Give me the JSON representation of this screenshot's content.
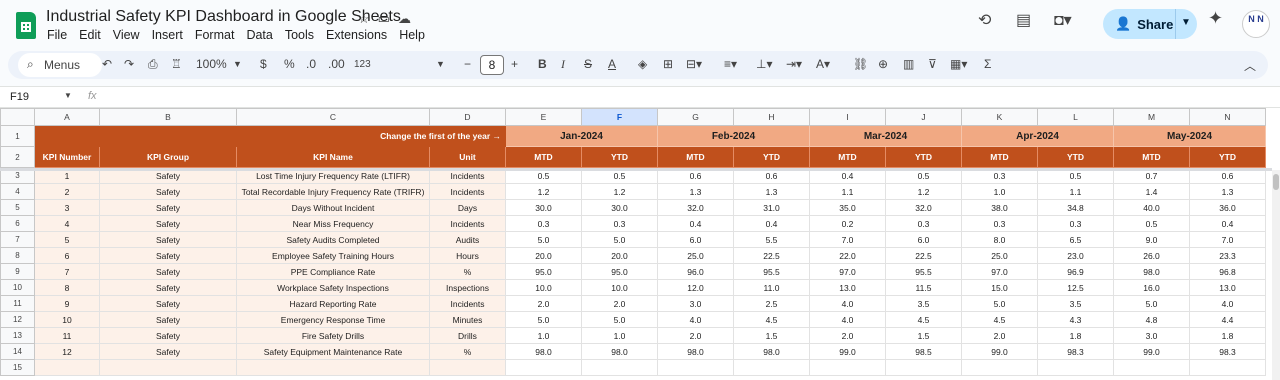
{
  "app": {
    "title": "Industrial Safety KPI Dashboard in Google Sheets",
    "menus": [
      "File",
      "Edit",
      "View",
      "Insert",
      "Format",
      "Data",
      "Tools",
      "Extensions",
      "Help"
    ],
    "share_label": "Share",
    "avatar_text": "N N"
  },
  "toolbar": {
    "menus_label": "Menus",
    "zoom": "100%",
    "currency": "$",
    "percent": "%",
    "dec_decrease": ".0",
    "dec_increase": ".00",
    "number_format": "123",
    "font_size": "8"
  },
  "formula_bar": {
    "cell_ref": "F19",
    "fx": "fx"
  },
  "columns": [
    "A",
    "B",
    "C",
    "D",
    "E",
    "F",
    "G",
    "H",
    "I",
    "J",
    "K",
    "L",
    "M",
    "N"
  ],
  "selected_column": "F",
  "header_row1": {
    "note": "Change the first of the year →",
    "months": [
      "Jan-2024",
      "Feb-2024",
      "Mar-2024",
      "Apr-2024",
      "May-2024"
    ]
  },
  "header_row2": {
    "kpi_number": "KPI Number",
    "kpi_group": "KPI Group",
    "kpi_name": "KPI Name",
    "unit": "Unit",
    "mtd": "MTD",
    "ytd": "YTD"
  },
  "rows": [
    {
      "row": "3",
      "num": "1",
      "group": "Safety",
      "name": "Lost Time Injury Frequency Rate (LTIFR)",
      "unit": "Incidents",
      "vals": [
        "0.5",
        "0.5",
        "0.6",
        "0.6",
        "0.4",
        "0.5",
        "0.3",
        "0.5",
        "0.7",
        "0.6"
      ]
    },
    {
      "row": "4",
      "num": "2",
      "group": "Safety",
      "name": "Total Recordable Injury Frequency Rate (TRIFR)",
      "unit": "Incidents",
      "vals": [
        "1.2",
        "1.2",
        "1.3",
        "1.3",
        "1.1",
        "1.2",
        "1.0",
        "1.1",
        "1.4",
        "1.3"
      ]
    },
    {
      "row": "5",
      "num": "3",
      "group": "Safety",
      "name": "Days Without Incident",
      "unit": "Days",
      "vals": [
        "30.0",
        "30.0",
        "32.0",
        "31.0",
        "35.0",
        "32.0",
        "38.0",
        "34.8",
        "40.0",
        "36.0"
      ]
    },
    {
      "row": "6",
      "num": "4",
      "group": "Safety",
      "name": "Near Miss Frequency",
      "unit": "Incidents",
      "vals": [
        "0.3",
        "0.3",
        "0.4",
        "0.4",
        "0.2",
        "0.3",
        "0.3",
        "0.3",
        "0.5",
        "0.4"
      ]
    },
    {
      "row": "7",
      "num": "5",
      "group": "Safety",
      "name": "Safety Audits Completed",
      "unit": "Audits",
      "vals": [
        "5.0",
        "5.0",
        "6.0",
        "5.5",
        "7.0",
        "6.0",
        "8.0",
        "6.5",
        "9.0",
        "7.0"
      ]
    },
    {
      "row": "8",
      "num": "6",
      "group": "Safety",
      "name": "Employee Safety Training Hours",
      "unit": "Hours",
      "vals": [
        "20.0",
        "20.0",
        "25.0",
        "22.5",
        "22.0",
        "22.5",
        "25.0",
        "23.0",
        "26.0",
        "23.3"
      ]
    },
    {
      "row": "9",
      "num": "7",
      "group": "Safety",
      "name": "PPE Compliance Rate",
      "unit": "%",
      "vals": [
        "95.0",
        "95.0",
        "96.0",
        "95.5",
        "97.0",
        "95.5",
        "97.0",
        "96.9",
        "98.0",
        "96.8"
      ]
    },
    {
      "row": "10",
      "num": "8",
      "group": "Safety",
      "name": "Workplace Safety Inspections",
      "unit": "Inspections",
      "vals": [
        "10.0",
        "10.0",
        "12.0",
        "11.0",
        "13.0",
        "11.5",
        "15.0",
        "12.5",
        "16.0",
        "13.0"
      ]
    },
    {
      "row": "11",
      "num": "9",
      "group": "Safety",
      "name": "Hazard Reporting Rate",
      "unit": "Incidents",
      "vals": [
        "2.0",
        "2.0",
        "3.0",
        "2.5",
        "4.0",
        "3.5",
        "5.0",
        "3.5",
        "5.0",
        "4.0"
      ]
    },
    {
      "row": "12",
      "num": "10",
      "group": "Safety",
      "name": "Emergency Response Time",
      "unit": "Minutes",
      "vals": [
        "5.0",
        "5.0",
        "4.0",
        "4.5",
        "4.0",
        "4.5",
        "4.5",
        "4.3",
        "4.8",
        "4.4"
      ]
    },
    {
      "row": "13",
      "num": "11",
      "group": "Safety",
      "name": "Fire Safety Drills",
      "unit": "Drills",
      "vals": [
        "1.0",
        "1.0",
        "2.0",
        "1.5",
        "2.0",
        "1.5",
        "2.0",
        "1.8",
        "3.0",
        "1.8"
      ]
    },
    {
      "row": "14",
      "num": "12",
      "group": "Safety",
      "name": "Safety Equipment Maintenance Rate",
      "unit": "%",
      "vals": [
        "98.0",
        "98.0",
        "98.0",
        "98.0",
        "99.0",
        "98.5",
        "99.0",
        "98.3",
        "99.0",
        "98.3"
      ]
    },
    {
      "row": "15",
      "num": "",
      "group": "",
      "name": "",
      "unit": "",
      "vals": [
        "",
        "",
        "",
        "",
        "",
        "",
        "",
        "",
        "",
        ""
      ]
    }
  ],
  "colors": {
    "header_dark": "#c0501c",
    "header_light": "#f1a983",
    "info_fill": "#fdf1e9",
    "share_bg": "#c2e7ff"
  }
}
